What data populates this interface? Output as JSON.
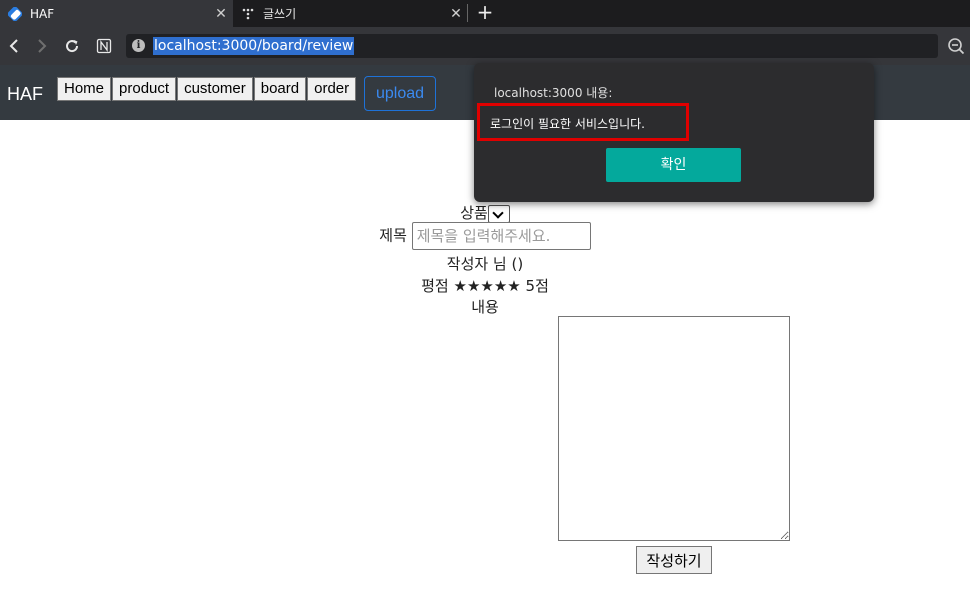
{
  "browser": {
    "tabs": [
      {
        "title": "HAF",
        "active": true,
        "close_label": "✕"
      },
      {
        "title": "글쓰기",
        "active": false,
        "close_label": "✕"
      }
    ],
    "new_tab_label": "+",
    "url": "localhost:3000/board/review",
    "info_glyph": "i"
  },
  "site": {
    "brand": "HAF",
    "nav": [
      "Home",
      "product",
      "customer",
      "board",
      "order"
    ],
    "upload_label": "upload"
  },
  "form": {
    "product_label": "상품",
    "title_label": "제목",
    "title_placeholder": "제목을 입력해주세요.",
    "author_text": "작성자 님 ()",
    "rating_label": "평점",
    "rating_stars": "★★★★★",
    "rating_value_text": "5점",
    "rating_value": 5,
    "content_label": "내용",
    "submit_label": "작성하기"
  },
  "dialog": {
    "origin_text": "localhost:3000 내용:",
    "message": "로그인이 필요한 서비스입니다.",
    "ok_label": "확인"
  },
  "colors": {
    "tabstrip_bg": "#1c1c1e",
    "toolbar_bg": "#35363a",
    "header_bg": "#343a40",
    "url_highlight": "#2f6fcf",
    "upload_accent": "#1e72d8",
    "dialog_ok": "#04a99c",
    "highlight_box": "#e00000"
  }
}
